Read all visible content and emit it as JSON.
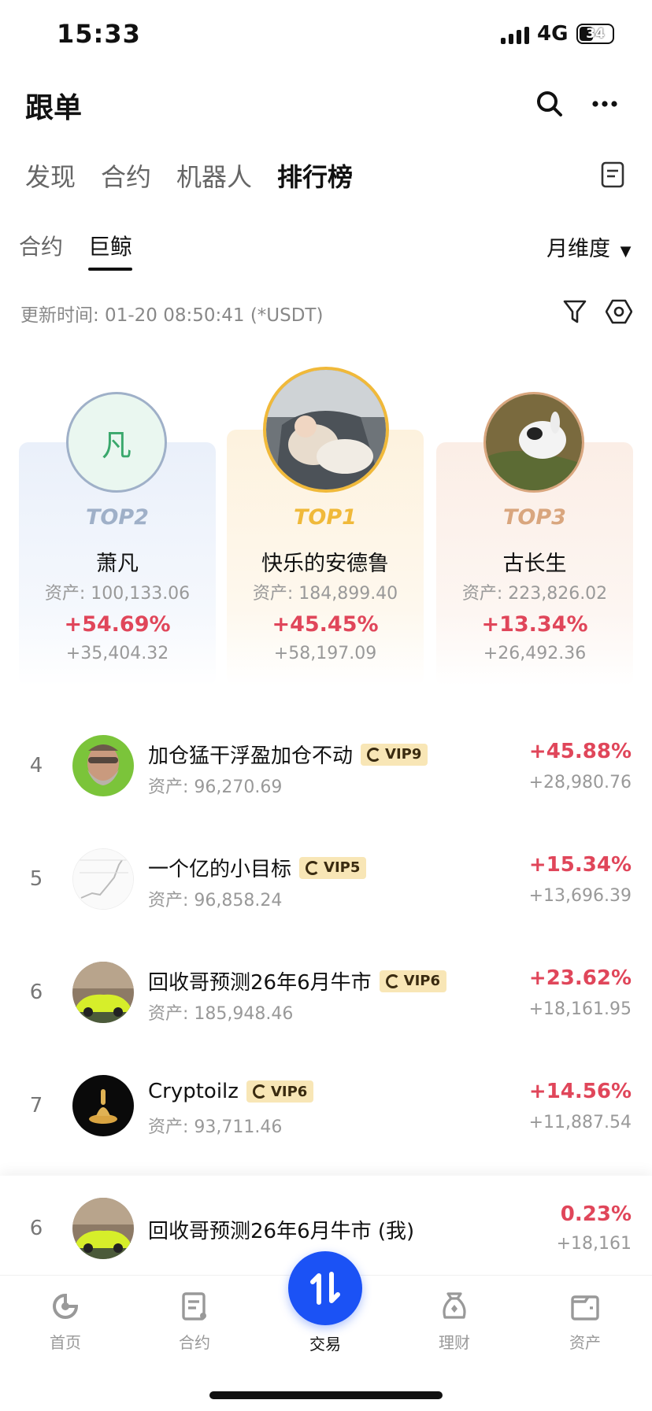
{
  "status_bar": {
    "time": "15:33",
    "network": "4G",
    "battery": "34"
  },
  "header": {
    "title": "跟单"
  },
  "top_tabs": [
    {
      "label": "发现",
      "active": false
    },
    {
      "label": "合约",
      "active": false
    },
    {
      "label": "机器人",
      "active": false
    },
    {
      "label": "排行榜",
      "active": true
    }
  ],
  "sub_tabs": [
    {
      "label": "合约",
      "active": false
    },
    {
      "label": "巨鲸",
      "active": true
    }
  ],
  "dimension_select": {
    "label": "月维度"
  },
  "update_time": "更新时间: 01-20 08:50:41 (*USDT)",
  "podium": [
    {
      "rank_label": "TOP2",
      "name": "萧凡",
      "avatar_text": "凡",
      "assets": "资产: 100,133.06",
      "pct": "+54.69%",
      "pnl": "+35,404.32"
    },
    {
      "rank_label": "TOP1",
      "name": "快乐的安德鲁",
      "assets": "资产: 184,899.40",
      "pct": "+45.45%",
      "pnl": "+58,197.09"
    },
    {
      "rank_label": "TOP3",
      "name": "古长生",
      "assets": "资产: 223,826.02",
      "pct": "+13.34%",
      "pnl": "+26,492.36"
    }
  ],
  "list": [
    {
      "rank": "4",
      "name": "加仓猛干浮盈加仓不动",
      "vip": "VIP9",
      "assets": "资产: 96,270.69",
      "pct": "+45.88%",
      "pnl": "+28,980.76"
    },
    {
      "rank": "5",
      "name": "一个亿的小目标",
      "vip": "VIP5",
      "assets": "资产: 96,858.24",
      "pct": "+15.34%",
      "pnl": "+13,696.39"
    },
    {
      "rank": "6",
      "name": "回收哥预测26年6月牛市",
      "vip": "VIP6",
      "assets": "资产: 185,948.46",
      "pct": "+23.62%",
      "pnl": "+18,161.95"
    },
    {
      "rank": "7",
      "name": "Cryptoilz",
      "vip": "VIP6",
      "assets": "资产: 93,711.46",
      "pct": "+14.56%",
      "pnl": "+11,887.54"
    }
  ],
  "me": {
    "rank": "6",
    "name": "回收哥预测26年6月牛市 (我)",
    "pct": "0.23%",
    "pnl": "+18,161"
  },
  "bottom_nav": [
    {
      "label": "首页",
      "icon": "home-icon"
    },
    {
      "label": "合约",
      "icon": "contract-icon"
    },
    {
      "label": "交易",
      "icon": "trade-icon",
      "active": true
    },
    {
      "label": "理财",
      "icon": "wealth-icon"
    },
    {
      "label": "资产",
      "icon": "wallet-icon"
    }
  ],
  "colors": {
    "accent": "#1b52f5",
    "up": "#e0465a",
    "top1": "#f0b93a",
    "top2": "#9fb0c8",
    "top3": "#d9a67e"
  }
}
